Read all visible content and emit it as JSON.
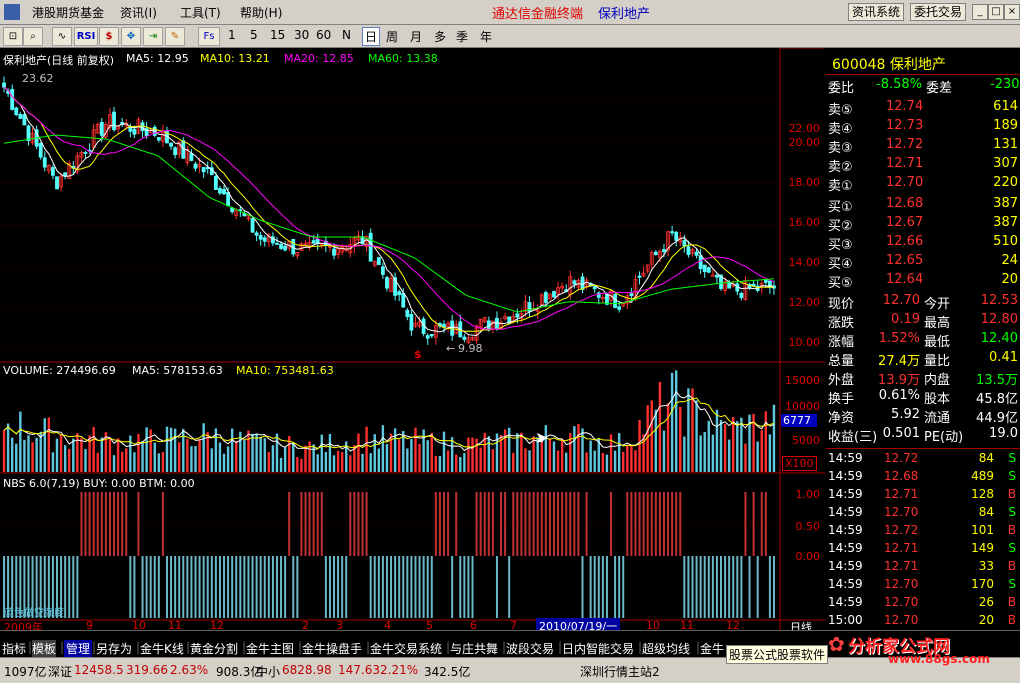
{
  "menu": {
    "items": [
      "港股期货基金",
      "资讯(I)",
      "工具(T)",
      "帮助(H)"
    ],
    "headline": "通达信金融终端",
    "stock_title": "保利地产",
    "buttons": [
      "资讯系统",
      "委托交易"
    ]
  },
  "toolbar": {
    "rsi_label": "RSI",
    "fs_label": "Fs",
    "periods": [
      "1",
      "5",
      "15",
      "30",
      "60",
      "N",
      "日",
      "周",
      "月",
      "多",
      "季",
      "年"
    ],
    "selected_period": "日"
  },
  "chart": {
    "main_header": {
      "name": "保利地产(日线 前复权)",
      "ma5": "MA5: 12.95",
      "ma10": "MA10: 13.21",
      "ma20": "MA20: 12.85",
      "ma60": "MA60: 13.38"
    },
    "high_label": "23.62",
    "low_label": "9.98",
    "price_ticks": [
      "22.00",
      "20.00",
      "18.00",
      "16.00",
      "14.00",
      "12.00",
      "10.00"
    ],
    "vol_header": {
      "name": "VOLUME: 274496.69",
      "ma5": "MA5: 578153.63",
      "ma10": "MA10: 753481.63"
    },
    "vol_ticks": [
      "15000",
      "10000",
      "5000"
    ],
    "vol_current": "6777",
    "vol_unit": "X100",
    "nbs_header": "NBS 6.0(7,19) BUY: 0.00 BTM: 0.00",
    "nbs_ticks": [
      "1.00",
      "0.50",
      "0.00"
    ],
    "nbs_bottom_label": "蓝色做空强度",
    "time_labels": [
      "2009年",
      "9",
      "10",
      "11",
      "12",
      "2",
      "3",
      "4",
      "5",
      "6",
      "7",
      "2010/07/19/一",
      "10",
      "11",
      "12"
    ],
    "period_label": "日线",
    "colors": {
      "up": "#ff3030",
      "down": "#54ffff",
      "ma5": "#ffffff",
      "ma10": "#ffff00",
      "ma20": "#ff00ff",
      "ma60": "#00ff00"
    }
  },
  "chart_data": {
    "type": "line",
    "title": "保利地产(日线 前复权)",
    "x": [
      "2009年",
      "9",
      "10",
      "11",
      "12",
      "2",
      "3",
      "4",
      "5",
      "6",
      "7",
      "8",
      "9",
      "10",
      "11",
      "12"
    ],
    "series": [
      {
        "name": "MA5",
        "values": [
          22.6,
          18.0,
          20.9,
          20.4,
          18.4,
          15.3,
          14.7,
          15.3,
          11.0,
          10.9,
          11.8,
          13.3,
          12.3,
          15.5,
          12.8,
          13.0
        ]
      },
      {
        "name": "MA60",
        "values": [
          19.9,
          20.3,
          20.1,
          19.3,
          17.3,
          16.2,
          15.4,
          15.4,
          14.4,
          12.6,
          11.8,
          12.3,
          12.2,
          12.9,
          13.2,
          13.4
        ]
      }
    ],
    "ylim": [
      9.5,
      23.8
    ],
    "volume": [
      8000,
      6000,
      5000,
      5200,
      6000,
      4500,
      4000,
      5500,
      5000,
      4500,
      5200,
      6000,
      4500,
      12000,
      7000,
      8000
    ],
    "volume_ylim": [
      0,
      16000
    ]
  },
  "quote": {
    "code_name": "600048 保利地产",
    "weibi_label": "委比",
    "weibi_value": "-8.58%",
    "weicha_label": "委差",
    "weicha_value": "-230",
    "asks": [
      {
        "label": "卖⑤",
        "price": "12.74",
        "vol": "614"
      },
      {
        "label": "卖④",
        "price": "12.73",
        "vol": "189"
      },
      {
        "label": "卖③",
        "price": "12.72",
        "vol": "131"
      },
      {
        "label": "卖②",
        "price": "12.71",
        "vol": "307"
      },
      {
        "label": "卖①",
        "price": "12.70",
        "vol": "220"
      }
    ],
    "bids": [
      {
        "label": "买①",
        "price": "12.68",
        "vol": "387"
      },
      {
        "label": "买②",
        "price": "12.67",
        "vol": "387"
      },
      {
        "label": "买③",
        "price": "12.66",
        "vol": "510"
      },
      {
        "label": "买④",
        "price": "12.65",
        "vol": "24"
      },
      {
        "label": "买⑤",
        "price": "12.64",
        "vol": "20"
      }
    ],
    "stats": [
      {
        "l1": "现价",
        "v1": "12.70",
        "l2": "今开",
        "v2": "12.53"
      },
      {
        "l1": "涨跌",
        "v1": "0.19",
        "l2": "最高",
        "v2": "12.80"
      },
      {
        "l1": "涨幅",
        "v1": "1.52%",
        "l2": "最低",
        "v2": "12.40"
      },
      {
        "l1": "总量",
        "v1": "27.4万",
        "l2": "量比",
        "v2": "0.41"
      },
      {
        "l1": "外盘",
        "v1": "13.9万",
        "l2": "内盘",
        "v2": "13.5万"
      },
      {
        "l1": "换手",
        "v1": "0.61%",
        "l2": "股本",
        "v2": "45.8亿"
      },
      {
        "l1": "净资",
        "v1": "5.92",
        "l2": "流通",
        "v2": "44.9亿"
      },
      {
        "l1": "收益(三)",
        "v1": "0.501",
        "l2": "PE(动)",
        "v2": "19.0"
      }
    ],
    "ticks": [
      {
        "t": "14:59",
        "p": "12.72",
        "v": "84",
        "s": "S"
      },
      {
        "t": "14:59",
        "p": "12.68",
        "v": "489",
        "s": "S"
      },
      {
        "t": "14:59",
        "p": "12.71",
        "v": "128",
        "s": "B"
      },
      {
        "t": "14:59",
        "p": "12.70",
        "v": "84",
        "s": "S"
      },
      {
        "t": "14:59",
        "p": "12.72",
        "v": "101",
        "s": "B"
      },
      {
        "t": "14:59",
        "p": "12.71",
        "v": "149",
        "s": "S"
      },
      {
        "t": "14:59",
        "p": "12.71",
        "v": "33",
        "s": "B"
      },
      {
        "t": "14:59",
        "p": "12.70",
        "v": "170",
        "s": "S"
      },
      {
        "t": "14:59",
        "p": "12.70",
        "v": "26",
        "s": "B"
      },
      {
        "t": "15:00",
        "p": "12.70",
        "v": "20",
        "s": "B"
      }
    ]
  },
  "tabs": [
    "指标",
    "模板",
    "管理",
    "另存为",
    "金牛K线",
    "黄金分割",
    "金牛主图",
    "金牛操盘手",
    "金牛交易系统",
    "与庄共舞",
    "波段交易",
    "日内智能交易",
    "超级均线",
    "金牛"
  ],
  "status": {
    "s1": "1097亿",
    "sz_label": "深证",
    "sz_val": "12458.5",
    "sz_chg": "319.66",
    "sz_pct": "2.63%",
    "s2": "908.3亿",
    "zx_label": "中小",
    "zx_val": "6828.98",
    "zx_chg": "147.63",
    "zx_pct": "2.21%",
    "s3": "342.5亿",
    "site": "深圳行情主站2",
    "ad": "股票公式股票软件"
  },
  "watermark": {
    "brand": "分析家公式网",
    "url": "www.88gs.com"
  }
}
